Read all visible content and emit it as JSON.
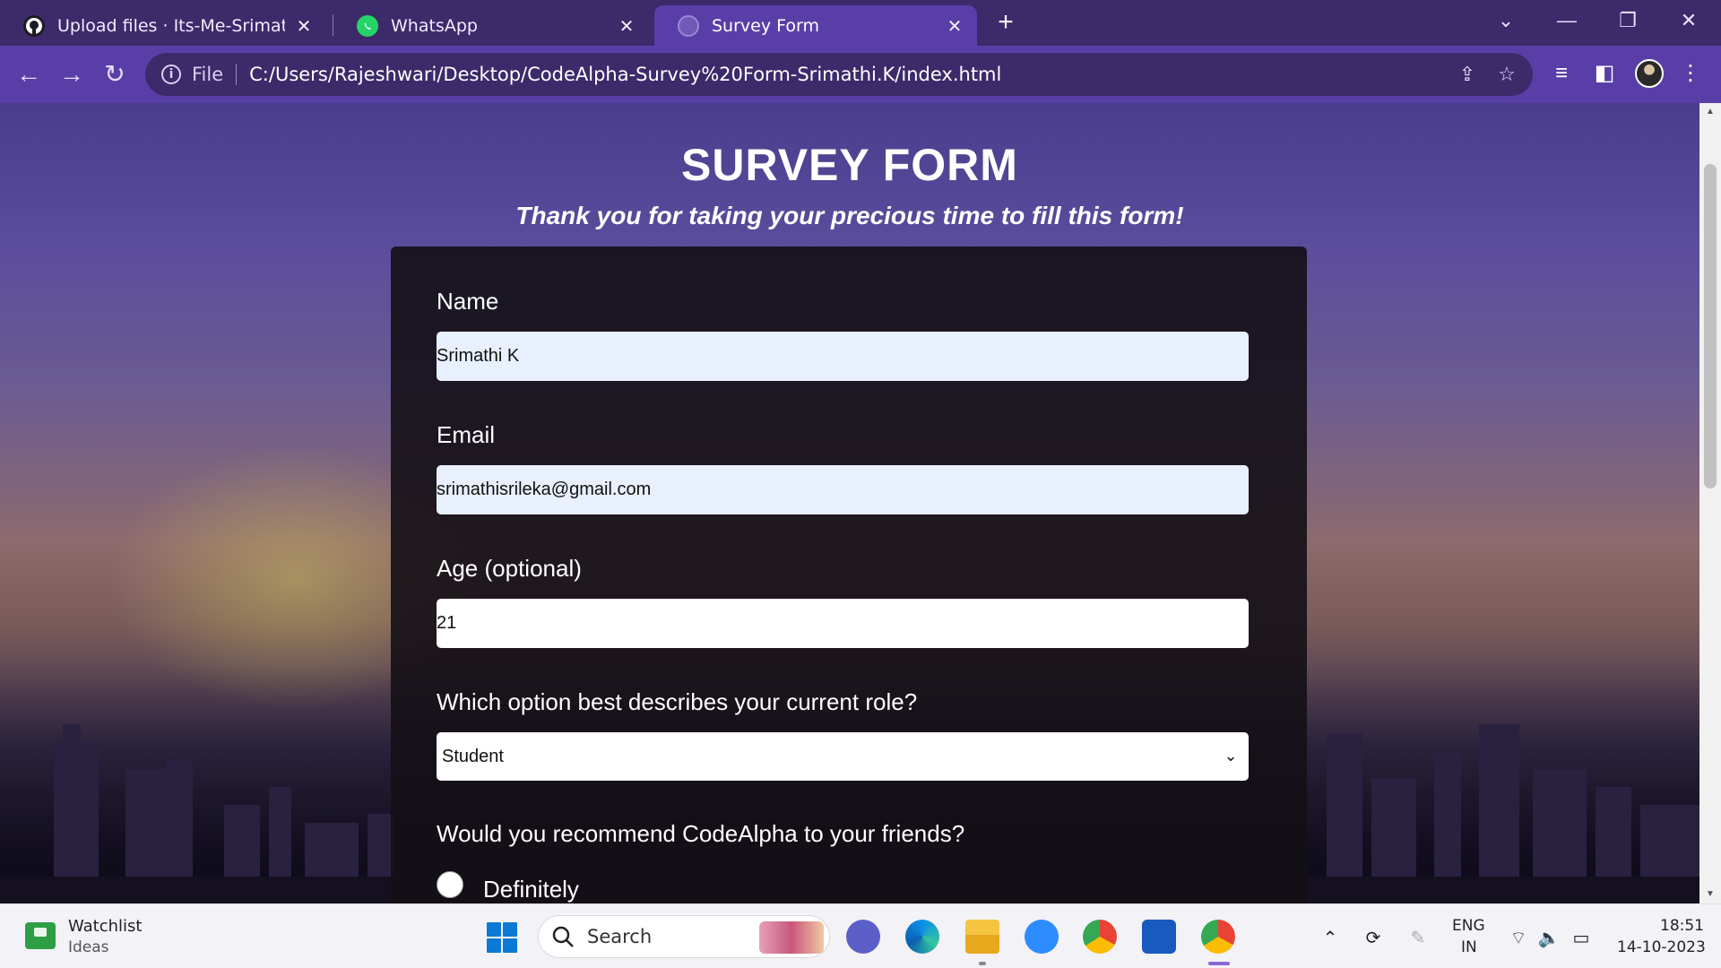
{
  "browser": {
    "tabs": [
      {
        "title": "Upload files · Its-Me-Srimathi/Co",
        "icon": "github-icon",
        "close": "✕"
      },
      {
        "title": "WhatsApp",
        "icon": "whatsapp-icon",
        "close": "✕"
      },
      {
        "title": "Survey Form",
        "icon": "globe-icon",
        "close": "✕",
        "active": true
      }
    ],
    "new_tab": "+",
    "address": {
      "scheme": "File",
      "url": "C:/Users/Rajeshwari/Desktop/CodeAlpha-Survey%20Form-Srimathi.K/index.html"
    },
    "accent_color": "#5a3ea8"
  },
  "page": {
    "title": "SURVEY FORM",
    "subtitle": "Thank you for taking your precious time to fill this form!",
    "form": {
      "name_label": "Name",
      "name_value": "Srimathi K",
      "email_label": "Email",
      "email_value": "srimathisrileka@gmail.com",
      "age_label": "Age (optional)",
      "age_value": "21",
      "role_label": "Which option best describes your current role?",
      "role_value": "Student",
      "recommend_label": "Would you recommend CodeAlpha to your friends?",
      "recommend_options": [
        "Definitely"
      ]
    }
  },
  "taskbar": {
    "widget_title": "Watchlist",
    "widget_sub": "Ideas",
    "search_placeholder": "Search",
    "apps": [
      "teams-icon",
      "edge-icon",
      "file-explorer-icon",
      "zoom-icon",
      "chrome-icon",
      "word-icon",
      "chrome-active-icon"
    ],
    "lang_top": "ENG",
    "lang_bottom": "IN",
    "time": "18:51",
    "date": "14-10-2023"
  }
}
